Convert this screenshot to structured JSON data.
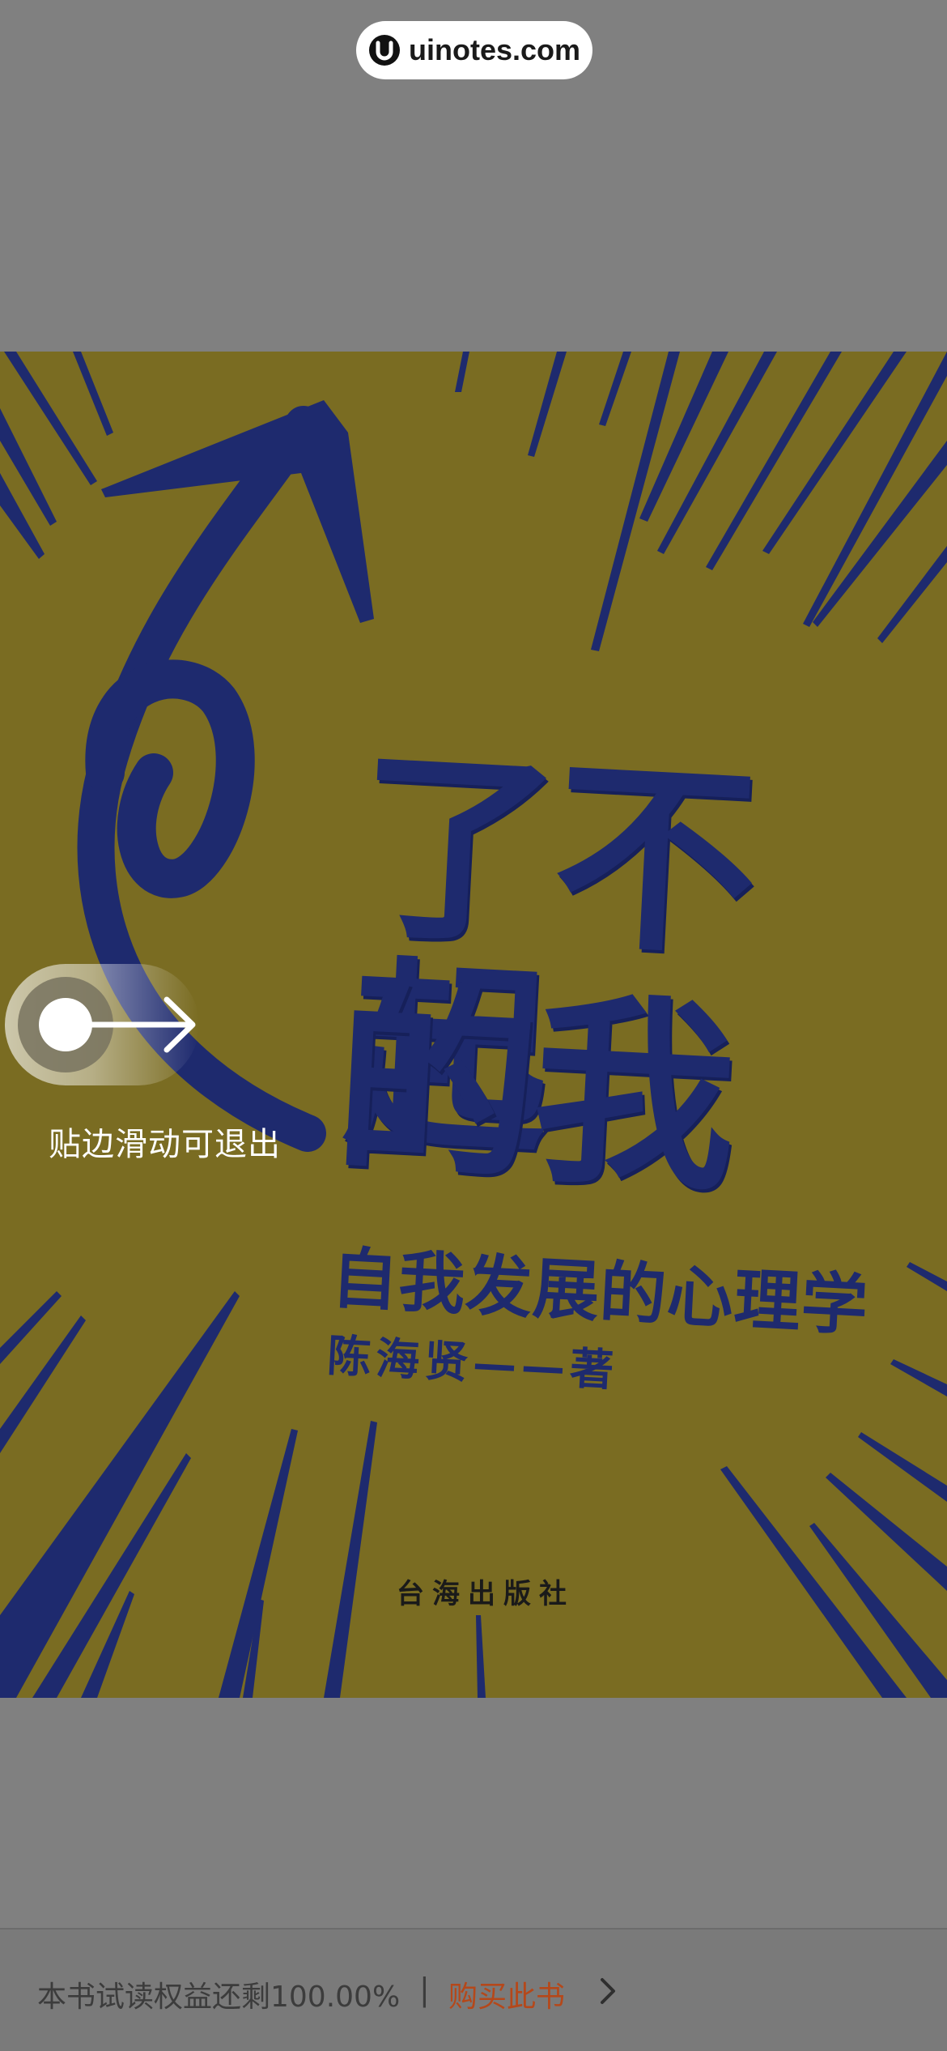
{
  "watermark": {
    "text": "uinotes.com"
  },
  "cover": {
    "title_line1": "了不起",
    "title_line2": "的我",
    "subtitle": "自我发展的心理学",
    "author": "陈海贤——著",
    "publisher": "台海出版社",
    "colors": {
      "background": "#7a6c22",
      "ink": "#1e2a6e"
    }
  },
  "swipe_hint": {
    "label": "贴边滑动可退出"
  },
  "bottom_bar": {
    "trial_text": "本书试读权益还剩100.00%",
    "separator": "|",
    "buy_label": "购买此书",
    "buy_color": "#b5481a"
  }
}
